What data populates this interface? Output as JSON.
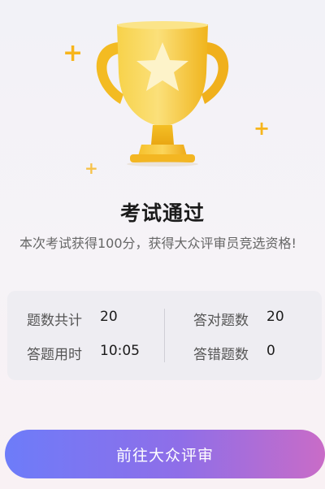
{
  "result": {
    "title": "考试通过",
    "description": "本次考试获得100分，获得大众评审员竞选资格!"
  },
  "stats": {
    "total_label": "题数共计",
    "total_value": "20",
    "correct_label": "答对题数",
    "correct_value": "20",
    "time_label": "答题用时",
    "time_value": "10:05",
    "wrong_label": "答错题数",
    "wrong_value": "0"
  },
  "action": {
    "button_label": "前往大众评审"
  },
  "icons": {
    "trophy": "trophy-icon",
    "sparkle": "sparkle-icon"
  },
  "colors": {
    "trophy_gold": "#f5c733",
    "button_gradient_start": "#6d7cf9",
    "button_gradient_end": "#c96cc7"
  }
}
